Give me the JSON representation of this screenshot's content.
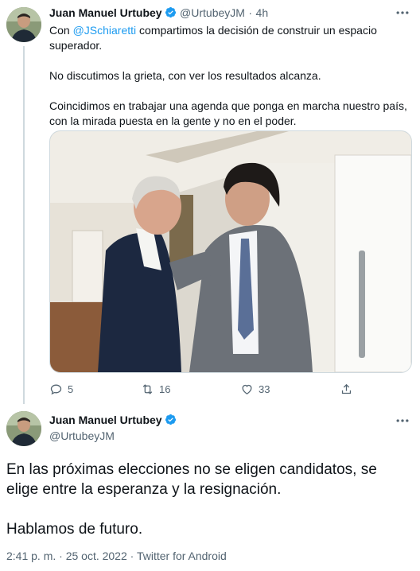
{
  "tweet1": {
    "name": "Juan Manuel Urtubey",
    "handle": "@UrtubeyJM",
    "separator": "·",
    "time": "4h",
    "line1_pre": "Con ",
    "mention": "@JSchiaretti",
    "line1_post": " compartimos la decisión de construir un espacio",
    "line2": "superador.",
    "para2": "No discutimos la grieta, con ver los resultados alcanza.",
    "para3_line1": "Coincidimos en trabajar una agenda que ponga en marcha nuestro país,",
    "para3_line2": "con la mirada puesta en la gente y no en el poder.",
    "replies": "5",
    "retweets": "16",
    "likes": "33"
  },
  "tweet2": {
    "name": "Juan Manuel Urtubey",
    "handle": "@UrtubeyJM",
    "line1": "En las próximas elecciones no se eligen candidatos, se",
    "line2": "elige entre la esperanza y la resignación.",
    "para2": "Hablamos de futuro.",
    "meta": "2:41 p. m. · 25 oct. 2022 · Twitter for Android"
  },
  "colors": {
    "accent": "#1d9bf0",
    "muted": "#536471",
    "text": "#0f1419"
  },
  "icons": [
    "verified-badge-icon",
    "more-icon",
    "reply-icon",
    "retweet-icon",
    "like-icon",
    "share-icon"
  ]
}
